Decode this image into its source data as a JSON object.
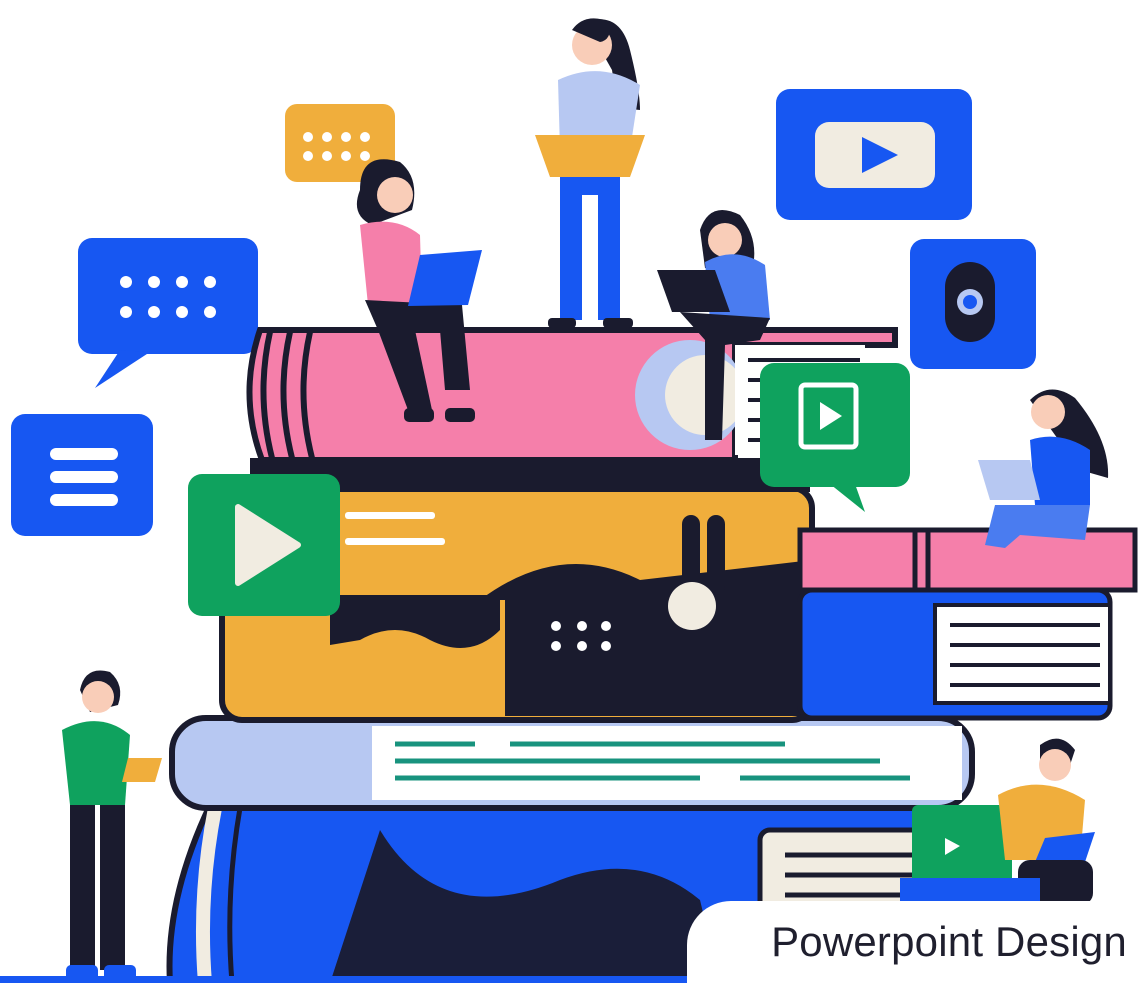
{
  "caption": {
    "text": "Powerpoint Design"
  },
  "colors": {
    "blue": "#1757F2",
    "navy": "#1A1B2E",
    "pink": "#F57FAA",
    "yellow": "#F0AE3C",
    "green": "#0FA25E",
    "light_blue": "#B7C8F2",
    "cream": "#F1ECE1",
    "teal": "#18937E",
    "skin": "#F9CDB8"
  },
  "icons": [
    "chat-bubble-dots-icon",
    "chat-bubble-menu-icon",
    "play-icon",
    "camera-icon",
    "video-tile-icon",
    "laptop-icon"
  ]
}
